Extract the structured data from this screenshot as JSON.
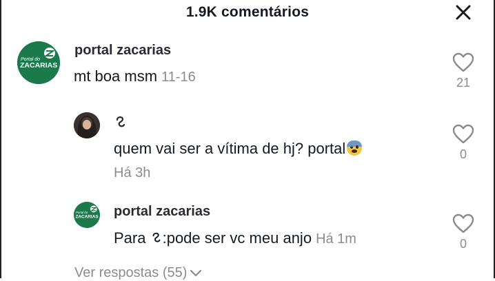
{
  "header": {
    "title": "1.9K comentários"
  },
  "icons": {
    "close": "close-icon",
    "like": "heart-outline-icon",
    "chevron": "chevron-down-icon",
    "user_glyph": "knot-symbol-icon",
    "emoji": "fearful-face-emoji"
  },
  "logo": {
    "brand": "Portal do ZACARIAS",
    "color": "#1a7a4c"
  },
  "comments": [
    {
      "username": "portal zacarias",
      "text": "mt boa msm",
      "time": "11-16",
      "likes": "21"
    },
    {
      "username": "",
      "text": "quem vai ser a vítima de hj? portal",
      "time": "Há 3h",
      "likes": "0"
    },
    {
      "username": "portal zacarias",
      "text_prefix": "Para ",
      "text": ":pode ser vc meu anjo",
      "time": "Há 1m",
      "likes": "0"
    }
  ],
  "view_replies": {
    "label": "Ver respostas (55)"
  }
}
